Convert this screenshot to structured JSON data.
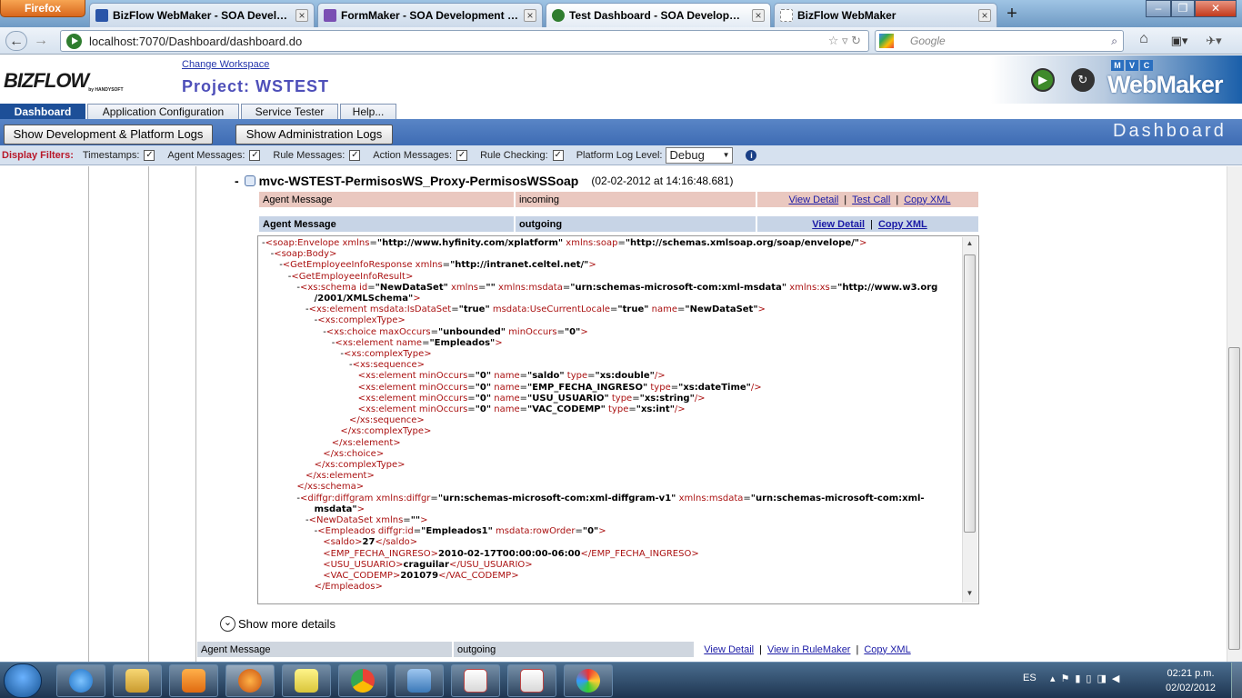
{
  "browser": {
    "firefox_label": "Firefox",
    "tabs": [
      {
        "title": "BizFlow WebMaker - SOA Developme...",
        "favicon": "bizflow-icon",
        "color": "#2a55a8",
        "active": false
      },
      {
        "title": "FormMaker - SOA Development Sim...",
        "favicon": "form-icon",
        "color": "#7a4fb3",
        "active": false
      },
      {
        "title": "Test Dashboard - SOA Development ...",
        "favicon": "play-icon",
        "color": "#2f7d2f",
        "active": true
      },
      {
        "title": "BizFlow WebMaker",
        "favicon": "blank-page-icon",
        "color": "#ffffff",
        "active": false
      }
    ],
    "new_tab": "+",
    "url": "localhost:7070/Dashboard/dashboard.do",
    "search_placeholder": "Google"
  },
  "app": {
    "logo": "BIZFLOW",
    "logo_sub": "by HANDYSOFT",
    "change_workspace": "Change Workspace",
    "project": "Project: WSTEST",
    "mvc_letters": [
      "M",
      "V",
      "C"
    ],
    "product": "WebMaker",
    "tabs": [
      "Dashboard",
      "Application Configuration",
      "Service Tester",
      "Help..."
    ],
    "active_tab": "Dashboard",
    "buttons": {
      "dev_logs": "Show Development & Platform Logs",
      "admin_logs": "Show Administration Logs"
    },
    "section_label": "Dashboard",
    "filters": {
      "label": "Display Filters:",
      "items": [
        {
          "label": "Timestamps:",
          "checked": true
        },
        {
          "label": "Agent Messages:",
          "checked": true
        },
        {
          "label": "Rule Messages:",
          "checked": true
        },
        {
          "label": "Action Messages:",
          "checked": true
        },
        {
          "label": "Rule Checking:",
          "checked": true
        }
      ],
      "log_level_label": "Platform Log Level:",
      "log_level_value": "Debug"
    }
  },
  "log": {
    "service_title": "mvc-WSTEST-PermisosWS_Proxy-PermisosWSSoap",
    "timestamp": "(02-02-2012 at 14:16:48.681)",
    "row1": {
      "type": "Agent Message",
      "direction": "incoming",
      "links": [
        "View Detail",
        "Test Call",
        "Copy XML"
      ]
    },
    "row2": {
      "type": "Agent Message",
      "direction": "outgoing",
      "links": [
        "View Detail",
        "Copy XML"
      ]
    },
    "row3": {
      "type": "Agent Message",
      "direction": "outgoing",
      "links": [
        "View Detail",
        "View in RuleMaker",
        "Copy XML"
      ]
    },
    "more_details": "Show more details",
    "xml_lines": [
      {
        "i": 0,
        "h": "-<span class='tg'>&lt;soap:Envelope</span> <span class='at'>xmlns</span>=<span class='av'>\"http://www.hyfinity.com/xplatform\"</span> <span class='at'>xmlns:soap</span>=<span class='av'>\"http://schemas.xmlsoap.org/soap/envelope/\"</span><span class='tg'>&gt;</span>"
      },
      {
        "i": 1,
        "h": "-<span class='tg'>&lt;soap:Body&gt;</span>"
      },
      {
        "i": 2,
        "h": "-<span class='tg'>&lt;GetEmployeeInfoResponse</span> <span class='at'>xmlns</span>=<span class='av'>\"http://intranet.celtel.net/\"</span><span class='tg'>&gt;</span>"
      },
      {
        "i": 3,
        "h": "-<span class='tg'>&lt;GetEmployeeInfoResult&gt;</span>"
      },
      {
        "i": 4,
        "h": "-<span class='tg'>&lt;xs:schema</span> <span class='at'>id</span>=<span class='av'>\"NewDataSet\"</span> <span class='at'>xmlns</span>=<span class='av'>\"\"</span> <span class='at'>xmlns:msdata</span>=<span class='av'>\"urn:schemas-microsoft-com:xml-msdata\"</span> <span class='at'>xmlns:xs</span>=<span class='av'>\"http://www.w3.org</span>"
      },
      {
        "i": 6,
        "h": "<span class='av'>/2001/XMLSchema\"</span><span class='tg'>&gt;</span>"
      },
      {
        "i": 5,
        "h": "-<span class='tg'>&lt;xs:element</span> <span class='at'>msdata:IsDataSet</span>=<span class='av'>\"true\"</span> <span class='at'>msdata:UseCurrentLocale</span>=<span class='av'>\"true\"</span> <span class='at'>name</span>=<span class='av'>\"NewDataSet\"</span><span class='tg'>&gt;</span>"
      },
      {
        "i": 6,
        "h": "-<span class='tg'>&lt;xs:complexType&gt;</span>"
      },
      {
        "i": 7,
        "h": "-<span class='tg'>&lt;xs:choice</span> <span class='at'>maxOccurs</span>=<span class='av'>\"unbounded\"</span> <span class='at'>minOccurs</span>=<span class='av'>\"0\"</span><span class='tg'>&gt;</span>"
      },
      {
        "i": 8,
        "h": "-<span class='tg'>&lt;xs:element</span> <span class='at'>name</span>=<span class='av'>\"Empleados\"</span><span class='tg'>&gt;</span>"
      },
      {
        "i": 9,
        "h": "-<span class='tg'>&lt;xs:complexType&gt;</span>"
      },
      {
        "i": 10,
        "h": "-<span class='tg'>&lt;xs:sequence&gt;</span>"
      },
      {
        "i": 11,
        "h": "<span class='tg'>&lt;xs:element</span> <span class='at'>minOccurs</span>=<span class='av'>\"0\"</span> <span class='at'>name</span>=<span class='av'>\"saldo\"</span> <span class='at'>type</span>=<span class='av'>\"xs:double\"</span><span class='tg'>/&gt;</span>"
      },
      {
        "i": 11,
        "h": "<span class='tg'>&lt;xs:element</span> <span class='at'>minOccurs</span>=<span class='av'>\"0\"</span> <span class='at'>name</span>=<span class='av'>\"EMP_FECHA_INGRESO\"</span> <span class='at'>type</span>=<span class='av'>\"xs:dateTime\"</span><span class='tg'>/&gt;</span>"
      },
      {
        "i": 11,
        "h": "<span class='tg'>&lt;xs:element</span> <span class='at'>minOccurs</span>=<span class='av'>\"0\"</span> <span class='at'>name</span>=<span class='av'>\"USU_USUARIO\"</span> <span class='at'>type</span>=<span class='av'>\"xs:string\"</span><span class='tg'>/&gt;</span>"
      },
      {
        "i": 11,
        "h": "<span class='tg'>&lt;xs:element</span> <span class='at'>minOccurs</span>=<span class='av'>\"0\"</span> <span class='at'>name</span>=<span class='av'>\"VAC_CODEMP\"</span> <span class='at'>type</span>=<span class='av'>\"xs:int\"</span><span class='tg'>/&gt;</span>"
      },
      {
        "i": 10,
        "h": "<span class='tg'>&lt;/xs:sequence&gt;</span>"
      },
      {
        "i": 9,
        "h": "<span class='tg'>&lt;/xs:complexType&gt;</span>"
      },
      {
        "i": 8,
        "h": "<span class='tg'>&lt;/xs:element&gt;</span>"
      },
      {
        "i": 7,
        "h": "<span class='tg'>&lt;/xs:choice&gt;</span>"
      },
      {
        "i": 6,
        "h": "<span class='tg'>&lt;/xs:complexType&gt;</span>"
      },
      {
        "i": 5,
        "h": "<span class='tg'>&lt;/xs:element&gt;</span>"
      },
      {
        "i": 4,
        "h": "<span class='tg'>&lt;/xs:schema&gt;</span>"
      },
      {
        "i": 4,
        "h": "-<span class='tg'>&lt;diffgr:diffgram</span> <span class='at'>xmlns:diffgr</span>=<span class='av'>\"urn:schemas-microsoft-com:xml-diffgram-v1\"</span> <span class='at'>xmlns:msdata</span>=<span class='av'>\"urn:schemas-microsoft-com:xml-</span>"
      },
      {
        "i": 6,
        "h": "<span class='av'>msdata\"</span><span class='tg'>&gt;</span>"
      },
      {
        "i": 5,
        "h": "-<span class='tg'>&lt;NewDataSet</span> <span class='at'>xmlns</span>=<span class='av'>\"\"</span><span class='tg'>&gt;</span>"
      },
      {
        "i": 6,
        "h": "-<span class='tg'>&lt;Empleados</span> <span class='at'>diffgr:id</span>=<span class='av'>\"Empleados1\"</span> <span class='at'>msdata:rowOrder</span>=<span class='av'>\"0\"</span><span class='tg'>&gt;</span>"
      },
      {
        "i": 7,
        "h": "<span class='tg'>&lt;saldo&gt;</span><span class='tx'>27</span><span class='tg'>&lt;/saldo&gt;</span>"
      },
      {
        "i": 7,
        "h": "<span class='tg'>&lt;EMP_FECHA_INGRESO&gt;</span><span class='tx'>2010-02-17T00:00:00-06:00</span><span class='tg'>&lt;/EMP_FECHA_INGRESO&gt;</span>"
      },
      {
        "i": 7,
        "h": "<span class='tg'>&lt;USU_USUARIO&gt;</span><span class='tx'>craguilar</span><span class='tg'>&lt;/USU_USUARIO&gt;</span>"
      },
      {
        "i": 7,
        "h": "<span class='tg'>&lt;VAC_CODEMP&gt;</span><span class='tx'>201079</span><span class='tg'>&lt;/VAC_CODEMP&gt;</span>"
      },
      {
        "i": 6,
        "h": "<span class='tg'>&lt;/Empleados&gt;</span>"
      }
    ]
  },
  "taskbar": {
    "language": "ES",
    "time": "02:21 p.m.",
    "date": "02/02/2012",
    "apps": [
      "internet-explorer-icon",
      "file-explorer-icon",
      "media-player-icon",
      "firefox-icon",
      "sticky-notes-icon",
      "chrome-icon",
      "monitor-icon",
      "java-icon",
      "java-icon",
      "paint-icon"
    ]
  }
}
